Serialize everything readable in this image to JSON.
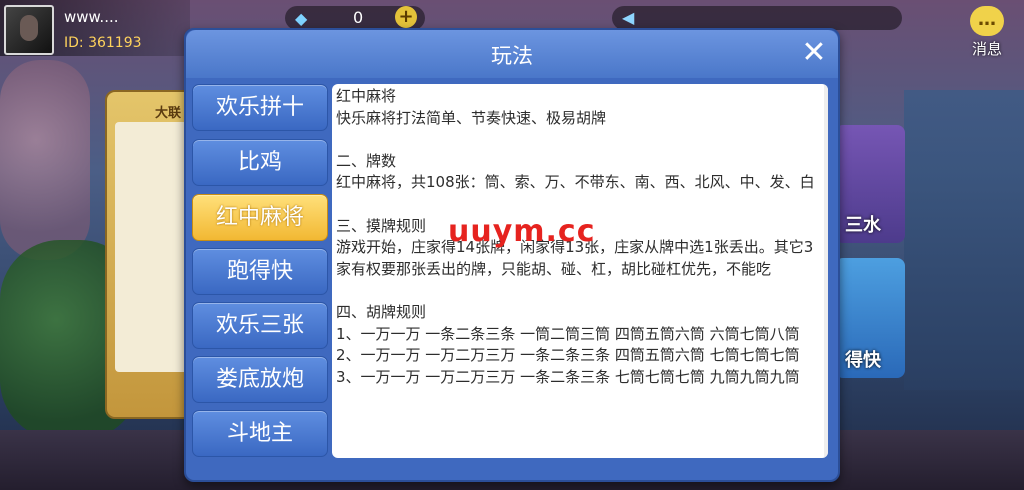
{
  "topbar": {
    "username": "www....",
    "user_id": "ID: 361193",
    "diamond_count": "0",
    "message_label": "消息"
  },
  "background": {
    "left_card_tag": "大联",
    "right_card_top_label": "三水",
    "right_card_bottom_label": "得快"
  },
  "dialog": {
    "title": "玩法",
    "tabs": [
      {
        "label": "欢乐拼十",
        "active": false
      },
      {
        "label": "比鸡",
        "active": false
      },
      {
        "label": "红中麻将",
        "active": true
      },
      {
        "label": "跑得快",
        "active": false
      },
      {
        "label": "欢乐三张",
        "active": false
      },
      {
        "label": "娄底放炮",
        "active": false
      },
      {
        "label": "斗地主",
        "active": false
      }
    ],
    "content": {
      "section1": "红中麻将\n快乐麻将打法简单、节奏快速、极易胡牌",
      "section2": "二、牌数\n红中麻将，共108张：筒、索、万、不带东、南、西、北风、中、发、白",
      "section3": "三、摸牌规则\n游戏开始，庄家得14张牌，闲家得13张，庄家从牌中选1张丢出。其它3家有权要那张丢出的牌，只能胡、碰、杠，胡比碰杠优先，不能吃",
      "section4": "四、胡牌规则\n1、一万一万 一条二条三条 一筒二筒三筒 四筒五筒六筒 六筒七筒八筒\n2、一万一万 一万二万三万 一条二条三条 四筒五筒六筒 七筒七筒七筒\n3、一万一万 一万二万三万 一条二条三条 七筒七筒七筒 九筒九筒九筒"
    }
  },
  "watermark": "uuym.cc",
  "colors": {
    "dialog_blue": "#3f69bf",
    "tab_active": "#f2b833",
    "watermark_red": "#e6231f"
  }
}
